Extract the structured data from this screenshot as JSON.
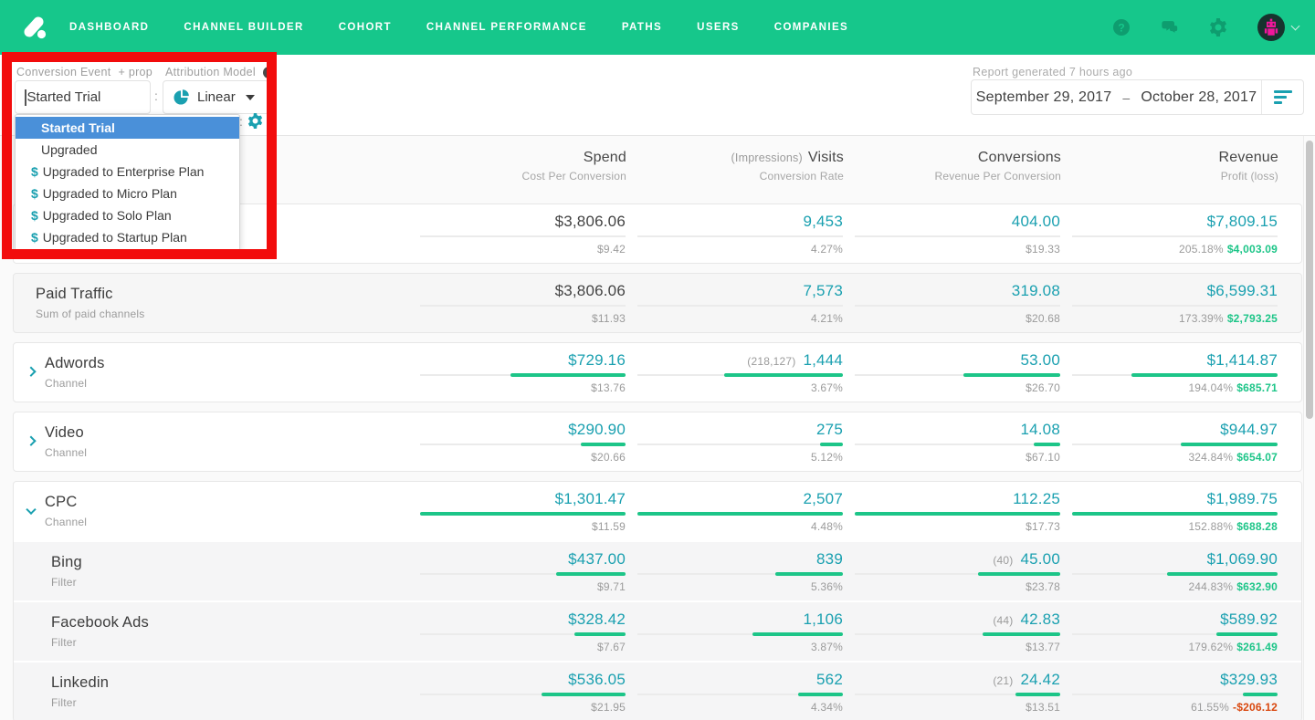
{
  "colors": {
    "nav_green": "#16C78B",
    "accent_teal": "#1AA0B0",
    "bar_green": "#1DC588",
    "profit_green": "#1DC588",
    "loss_red": "#D9480F",
    "highlight_blue": "#4A90D9",
    "annotation_red": "#F20C0C",
    "avatar_magenta": "#F2169C"
  },
  "nav": {
    "items": [
      "DASHBOARD",
      "CHANNEL BUILDER",
      "COHORT",
      "CHANNEL PERFORMANCE",
      "PATHS",
      "USERS",
      "COMPANIES"
    ],
    "right_icons": [
      "help",
      "chat",
      "settings",
      "avatar"
    ]
  },
  "filters": {
    "conversion_event_label": "Conversion Event",
    "prop_label": "+ prop",
    "input_value": "Started Trial",
    "separator": ":",
    "attribution_model_label": "Attribution Model",
    "model_value": "Linear",
    "dropdown_items": [
      {
        "label": "Started Trial",
        "money": false,
        "selected": true
      },
      {
        "label": "Upgraded",
        "money": false,
        "selected": false
      },
      {
        "label": "Upgraded to Enterprise Plan",
        "money": true,
        "selected": false
      },
      {
        "label": "Upgraded to Micro Plan",
        "money": true,
        "selected": false
      },
      {
        "label": "Upgraded to Solo Plan",
        "money": true,
        "selected": false
      },
      {
        "label": "Upgraded to Startup Plan",
        "money": true,
        "selected": false
      }
    ]
  },
  "report": {
    "generated_label": "Report generated 7 hours ago",
    "date_start": "September 29, 2017",
    "date_separator": "–",
    "date_end": "October 28, 2017"
  },
  "table": {
    "columns": [
      {
        "pre": "",
        "label": "Spend",
        "sub": "Cost Per Conversion"
      },
      {
        "pre": "(Impressions)",
        "label": "Visits",
        "sub": "Conversion Rate"
      },
      {
        "pre": "",
        "label": "Conversions",
        "sub": "Revenue Per Conversion"
      },
      {
        "pre": "",
        "label": "Revenue",
        "sub": "Profit (loss)"
      }
    ],
    "cards": [
      {
        "gray": false,
        "group": false,
        "rows": [
          {
            "title": "",
            "subtitle": "",
            "chevron": "",
            "indent": "summary",
            "name": "total",
            "cells": [
              {
                "value": "$3,806.06",
                "dark": true,
                "sub": "$9.42",
                "fraction": 0
              },
              {
                "value": "9,453",
                "dark": false,
                "sub": "4.27%",
                "fraction": 0
              },
              {
                "value": "404.00",
                "dark": false,
                "sub": "$19.33",
                "fraction": 0
              },
              {
                "value": "$7,809.15",
                "dark": false,
                "fraction": 0,
                "pct": "205.18%",
                "profit": "$4,003.09",
                "negative": false
              }
            ]
          }
        ]
      },
      {
        "gray": true,
        "group": false,
        "rows": [
          {
            "title": "Paid Traffic",
            "subtitle": "Sum of paid channels",
            "chevron": "",
            "indent": "summary",
            "name": "paid-traffic",
            "cells": [
              {
                "value": "$3,806.06",
                "dark": true,
                "sub": "$11.93",
                "fraction": 0
              },
              {
                "value": "7,573",
                "dark": false,
                "sub": "4.21%",
                "fraction": 0
              },
              {
                "value": "319.08",
                "dark": false,
                "sub": "$20.68",
                "fraction": 0
              },
              {
                "value": "$6,599.31",
                "dark": false,
                "fraction": 0,
                "pct": "173.39%",
                "profit": "$2,793.25",
                "negative": false
              }
            ]
          }
        ]
      },
      {
        "gray": false,
        "group": false,
        "rows": [
          {
            "title": "Adwords",
            "subtitle": "Channel",
            "chevron": "right",
            "indent": "channel",
            "name": "adwords",
            "cells": [
              {
                "value": "$729.16",
                "dark": false,
                "sub": "$13.76",
                "fraction": 0.56
              },
              {
                "value": "1,444",
                "paren": "(218,127)",
                "dark": false,
                "sub": "3.67%",
                "fraction": 0.58
              },
              {
                "value": "53.00",
                "dark": false,
                "sub": "$26.70",
                "fraction": 0.47
              },
              {
                "value": "$1,414.87",
                "dark": false,
                "fraction": 0.71,
                "pct": "194.04%",
                "profit": "$685.71",
                "negative": false
              }
            ]
          }
        ]
      },
      {
        "gray": false,
        "group": false,
        "rows": [
          {
            "title": "Video",
            "subtitle": "Channel",
            "chevron": "right",
            "indent": "channel",
            "name": "video",
            "cells": [
              {
                "value": "$290.90",
                "dark": false,
                "sub": "$20.66",
                "fraction": 0.22
              },
              {
                "value": "275",
                "dark": false,
                "sub": "5.12%",
                "fraction": 0.11
              },
              {
                "value": "14.08",
                "dark": false,
                "sub": "$67.10",
                "fraction": 0.13
              },
              {
                "value": "$944.97",
                "dark": false,
                "fraction": 0.47,
                "pct": "324.84%",
                "profit": "$654.07",
                "negative": false
              }
            ]
          }
        ]
      },
      {
        "gray": false,
        "group": true,
        "rows": [
          {
            "title": "CPC",
            "subtitle": "Channel",
            "chevron": "down",
            "indent": "channel",
            "name": "cpc",
            "cells": [
              {
                "value": "$1,301.47",
                "dark": false,
                "sub": "$11.59",
                "fraction": 1
              },
              {
                "value": "2,507",
                "dark": false,
                "sub": "4.48%",
                "fraction": 1
              },
              {
                "value": "112.25",
                "dark": false,
                "sub": "$17.73",
                "fraction": 1
              },
              {
                "value": "$1,989.75",
                "dark": false,
                "fraction": 1,
                "pct": "152.88%",
                "profit": "$688.28",
                "negative": false
              }
            ]
          },
          {
            "title": "Bing",
            "subtitle": "Filter",
            "chevron": "",
            "indent": "filter",
            "name": "bing",
            "child": true,
            "cells": [
              {
                "value": "$437.00",
                "dark": false,
                "sub": "$9.71",
                "fraction": 0.34
              },
              {
                "value": "839",
                "dark": false,
                "sub": "5.36%",
                "fraction": 0.33
              },
              {
                "value": "45.00",
                "paren": "(40)",
                "dark": false,
                "sub": "$23.78",
                "fraction": 0.4
              },
              {
                "value": "$1,069.90",
                "dark": false,
                "fraction": 0.54,
                "pct": "244.83%",
                "profit": "$632.90",
                "negative": false
              }
            ]
          },
          {
            "title": "Facebook Ads",
            "subtitle": "Filter",
            "chevron": "",
            "indent": "filter",
            "name": "facebook-ads",
            "child": true,
            "cells": [
              {
                "value": "$328.42",
                "dark": false,
                "sub": "$7.67",
                "fraction": 0.25
              },
              {
                "value": "1,106",
                "dark": false,
                "sub": "3.87%",
                "fraction": 0.44
              },
              {
                "value": "42.83",
                "paren": "(44)",
                "dark": false,
                "sub": "$13.77",
                "fraction": 0.38
              },
              {
                "value": "$589.92",
                "dark": false,
                "fraction": 0.3,
                "pct": "179.62%",
                "profit": "$261.49",
                "negative": false
              }
            ]
          },
          {
            "title": "Linkedin",
            "subtitle": "Filter",
            "chevron": "",
            "indent": "filter",
            "name": "linkedin",
            "child": true,
            "cells": [
              {
                "value": "$536.05",
                "dark": false,
                "sub": "$21.95",
                "fraction": 0.41
              },
              {
                "value": "562",
                "dark": false,
                "sub": "4.34%",
                "fraction": 0.22
              },
              {
                "value": "24.42",
                "paren": "(21)",
                "dark": false,
                "sub": "$13.51",
                "fraction": 0.22
              },
              {
                "value": "$329.93",
                "dark": false,
                "fraction": 0.17,
                "pct": "61.55%",
                "profit": "-$206.12",
                "negative": true
              }
            ]
          }
        ]
      }
    ]
  }
}
